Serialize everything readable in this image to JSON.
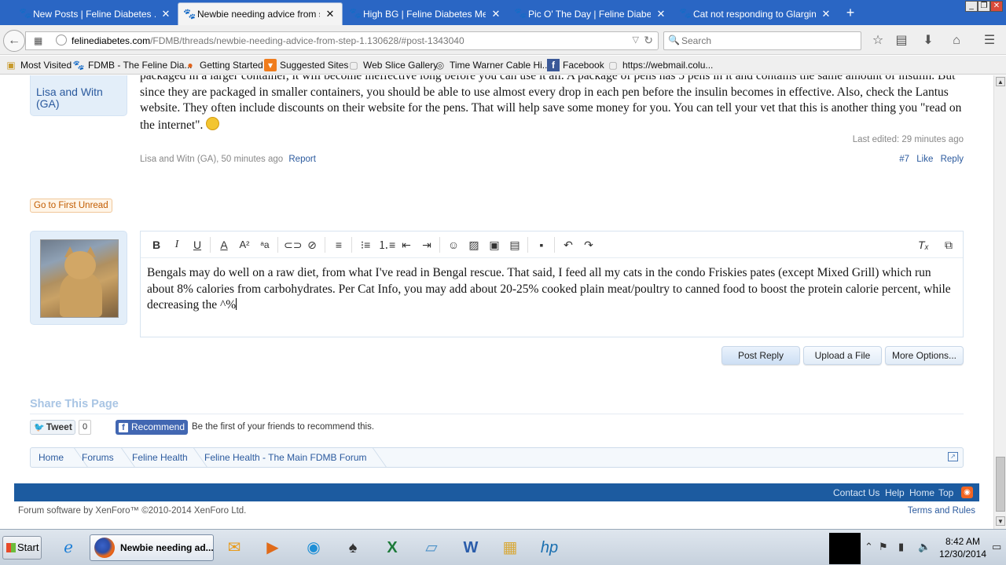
{
  "browser": {
    "tabs": [
      {
        "title": "New Posts | Feline Diabetes ...",
        "active": false
      },
      {
        "title": "Newbie needing advice from s...",
        "active": true
      },
      {
        "title": "High BG | Feline Diabetes Mes...",
        "active": false
      },
      {
        "title": "Pic O' The Day | Feline Diabet...",
        "active": false
      },
      {
        "title": "Cat not responding to Glargin...",
        "active": false
      }
    ],
    "new_tab": "+",
    "url_domain": "felinediabetes.com",
    "url_path": "/FDMB/threads/newbie-needing-advice-from-step-1.130628/#post-1343040",
    "search_placeholder": "Search",
    "bookmarks": [
      {
        "label": "Most Visited",
        "icon": "folder-icon"
      },
      {
        "label": "FDMB - The Feline Dia...",
        "icon": "paw-icon"
      },
      {
        "label": "Getting Started",
        "icon": "firefox-icon"
      },
      {
        "label": "Suggested Sites",
        "icon": "suggested-icon"
      },
      {
        "label": "Web Slice Gallery",
        "icon": "page-icon"
      },
      {
        "label": "Time Warner Cable Hi...",
        "icon": "twc-icon"
      },
      {
        "label": "Facebook",
        "icon": "facebook-icon"
      },
      {
        "label": "https://webmail.colu...",
        "icon": "page-icon"
      }
    ]
  },
  "previous_post": {
    "username": "Lisa and Witn (GA)",
    "message": "packaged in a larger container, it will become ineffective long before you can use it all. A package of pens has 5 pens in it and contains the same amount of insulin. But since they are packaged in smaller containers, you should be able to use almost every drop in each pen before the insulin becomes in effective. Also, check the Lantus website. They often include discounts on their website for the pens. That will help save some money for you. You can tell your vet that this is another thing you \"read on the internet\".",
    "last_edited": "Last edited: 29 minutes ago",
    "meta": "Lisa and Witn (GA), 50 minutes ago",
    "report": "Report",
    "post_number": "#7",
    "like": "Like",
    "reply": "Reply"
  },
  "go_first_unread": "Go to First Unread",
  "reply_editor": {
    "text": "Bengals may do well on a raw diet, from what I've read in Bengal rescue. That said, I feed all my cats in the condo Friskies pates (except Mixed Grill) which run about 8% calories from carbohydrates. Per Cat Info, you may add about 20-25% cooked plain meat/poultry to canned food to boost the protein calorie percent, while decreasing the ^%",
    "toolbar": [
      "bold-icon",
      "italic-icon",
      "underline-icon",
      "font-color-icon",
      "font-size-icon",
      "font-family-icon",
      "link-icon",
      "unlink-icon",
      "align-icon",
      "bullet-list-icon",
      "number-list-icon",
      "outdent-icon",
      "indent-icon",
      "smilie-icon",
      "image-icon",
      "media-icon",
      "quote-icon",
      "save-draft-icon",
      "undo-icon",
      "redo-icon",
      "remove-format-icon",
      "toggle-bbcode-icon"
    ],
    "buttons": {
      "post_reply": "Post Reply",
      "upload": "Upload a File",
      "more": "More Options..."
    }
  },
  "share": {
    "title": "Share This Page",
    "tweet": "Tweet",
    "tweet_count": "0",
    "recommend": "Recommend",
    "fb_text": "Be the first of your friends to recommend this."
  },
  "breadcrumb": [
    "Home",
    "Forums",
    "Feline Health",
    "Feline Health - The Main FDMB Forum"
  ],
  "footer": {
    "links": [
      "Contact Us",
      "Help",
      "Home",
      "Top"
    ],
    "copyright": "Forum software by XenForo™ ©2010-2014 XenForo Ltd.",
    "terms": "Terms and Rules"
  },
  "taskbar": {
    "start": "Start",
    "active_window": "Newbie needing ad...",
    "time": "8:42 AM",
    "date": "12/30/2014"
  },
  "colors": {
    "tab_bar": "#2a66c4",
    "link_blue": "#2b5a9e",
    "footer_bar": "#1c5ba0",
    "facebook": "#4267b2"
  }
}
